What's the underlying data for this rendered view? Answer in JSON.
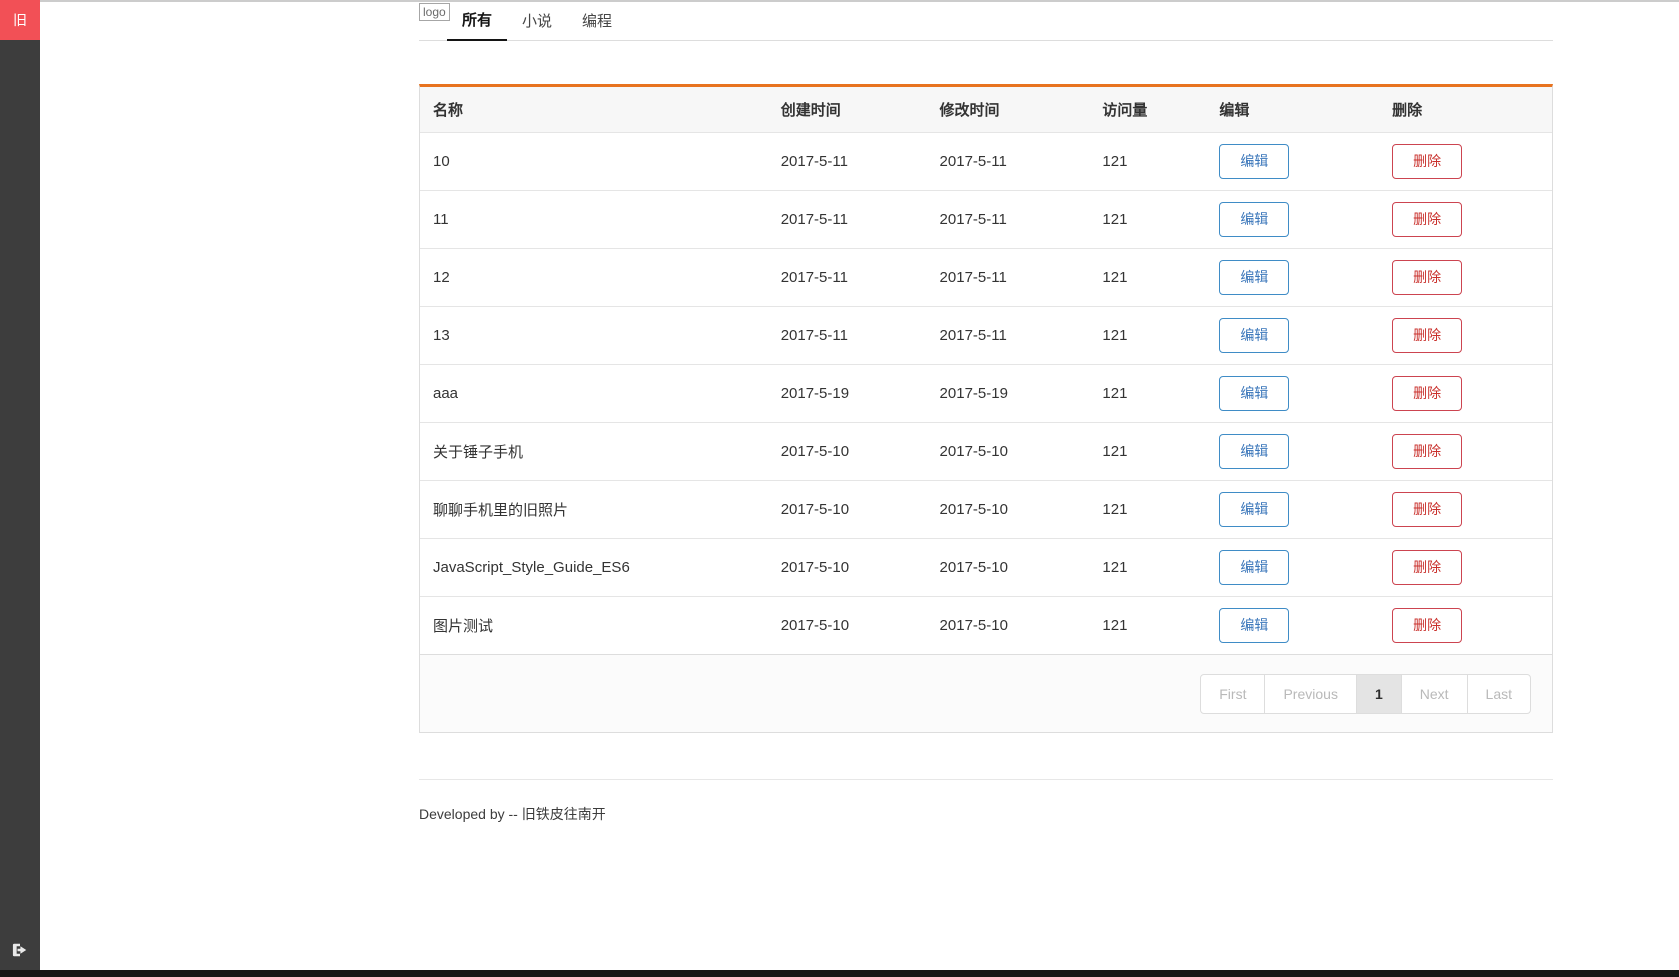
{
  "sidebar": {
    "badge_label": "旧",
    "logout_icon": "sign-out-icon"
  },
  "navbar": {
    "logo_alt": "logo",
    "tabs": [
      {
        "label": "所有",
        "active": true
      },
      {
        "label": "小说",
        "active": false
      },
      {
        "label": "编程",
        "active": false
      }
    ]
  },
  "table": {
    "columns": [
      "名称",
      "创建时间",
      "修改时间",
      "访问量",
      "编辑",
      "删除"
    ],
    "edit_button_label": "编辑",
    "delete_button_label": "删除",
    "rows": [
      {
        "name": "10",
        "created": "2017-5-11",
        "modified": "2017-5-11",
        "views": "121"
      },
      {
        "name": "11",
        "created": "2017-5-11",
        "modified": "2017-5-11",
        "views": "121"
      },
      {
        "name": "12",
        "created": "2017-5-11",
        "modified": "2017-5-11",
        "views": "121"
      },
      {
        "name": "13",
        "created": "2017-5-11",
        "modified": "2017-5-11",
        "views": "121"
      },
      {
        "name": "aaa",
        "created": "2017-5-19",
        "modified": "2017-5-19",
        "views": "121"
      },
      {
        "name": "关于锤子手机",
        "created": "2017-5-10",
        "modified": "2017-5-10",
        "views": "121"
      },
      {
        "name": "聊聊手机里的旧照片",
        "created": "2017-5-10",
        "modified": "2017-5-10",
        "views": "121"
      },
      {
        "name": "JavaScript_Style_Guide_ES6",
        "created": "2017-5-10",
        "modified": "2017-5-10",
        "views": "121"
      },
      {
        "name": "图片测试",
        "created": "2017-5-10",
        "modified": "2017-5-10",
        "views": "121"
      }
    ]
  },
  "pagination": {
    "active_page": "1",
    "items": [
      {
        "label": "First",
        "state": "disabled"
      },
      {
        "label": "Previous",
        "state": "disabled"
      },
      {
        "label": "1",
        "state": "active"
      },
      {
        "label": "Next",
        "state": "disabled"
      },
      {
        "label": "Last",
        "state": "disabled"
      }
    ]
  },
  "footer": {
    "text": "Developed by -- 旧铁皮往南开"
  },
  "colors": {
    "badge_red": "#f25056",
    "sidebar_dark": "#3d3d3d",
    "table_accent_orange": "#e8731f",
    "edit_blue": "#3a76ba",
    "delete_red": "#c9302c",
    "header_bg": "#f7f7f7",
    "border_gray": "#dddddd",
    "bottom_bar_black": "#161616"
  }
}
